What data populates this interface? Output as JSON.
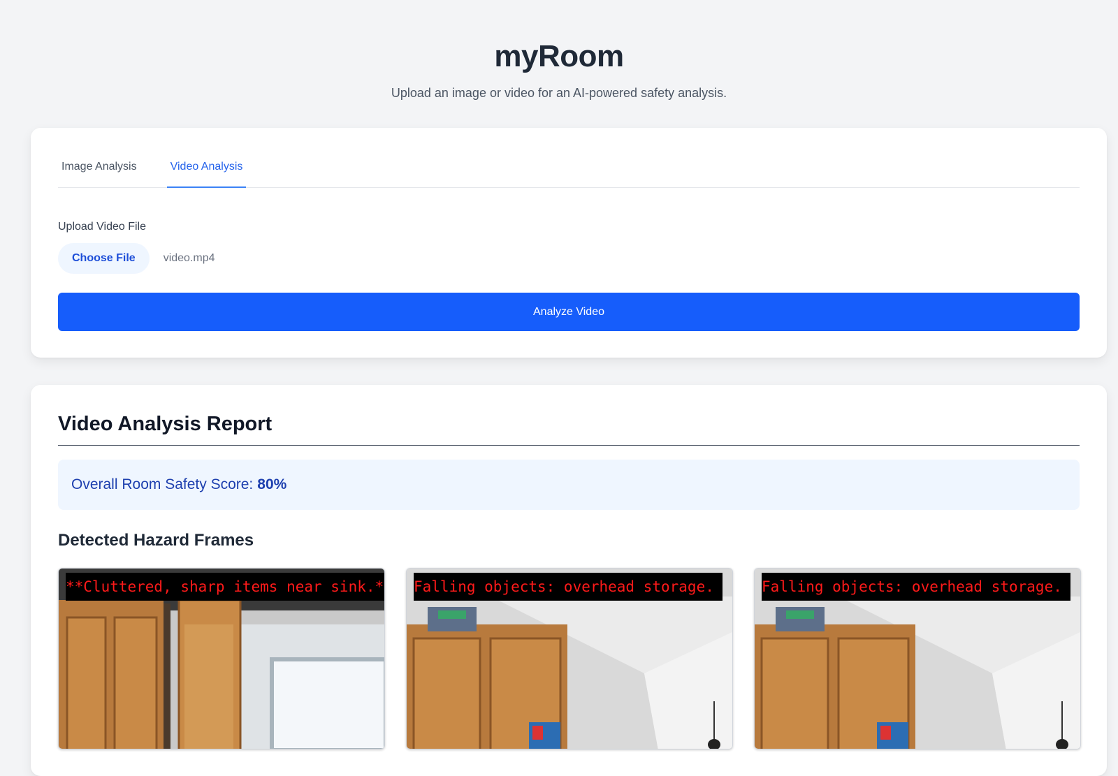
{
  "header": {
    "title": "myRoom",
    "subtitle": "Upload an image or video for an AI-powered safety analysis."
  },
  "tabs": [
    {
      "label": "Image Analysis",
      "active": false
    },
    {
      "label": "Video Analysis",
      "active": true
    }
  ],
  "upload": {
    "label": "Upload Video File",
    "choose_button": "Choose File",
    "file_name": "video.mp4",
    "analyze_button": "Analyze Video"
  },
  "report": {
    "title": "Video Analysis Report",
    "score_label": "Overall Room Safety Score:",
    "score_value": "80%",
    "hazard_heading": "Detected Hazard Frames",
    "frames": [
      {
        "caption": "**Cluttered, sharp items near sink.**"
      },
      {
        "caption": "Falling objects: overhead storage."
      },
      {
        "caption": "Falling objects: overhead storage."
      }
    ]
  },
  "colors": {
    "accent": "#2563eb",
    "button": "#165dfb",
    "score_bg": "#eff6ff",
    "caption_text": "#ff1a1a"
  }
}
